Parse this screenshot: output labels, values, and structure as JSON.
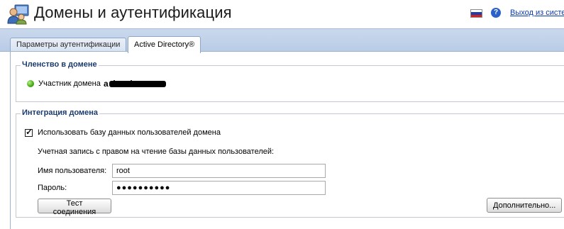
{
  "header": {
    "title": "Домены и аутентификация",
    "logout_label": "Выход из систе",
    "help_label": "?",
    "app_icon": "users-domain-icon",
    "flag_colors": [
      "#ffffff",
      "#1f3ea8",
      "#d0221c"
    ]
  },
  "tabs": [
    {
      "label": "Параметры аутентификации",
      "active": false
    },
    {
      "label": "Active Directory®",
      "active": true
    }
  ],
  "membership": {
    "legend": "Членство в домене",
    "status_label": "Участник домена",
    "domain_name": "a            .local",
    "status_color": "#4cae1c"
  },
  "integration": {
    "legend": "Интеграция домена",
    "use_domain_db_label": "Использовать базу данных пользователей домена",
    "use_domain_db_checked": true,
    "account_caption": "Учетная запись с правом на чтение базы данных пользователей:",
    "username_label": "Имя пользователя:",
    "username_value": "root",
    "password_label": "Пароль:",
    "password_mask": "●●●●●●●●●●",
    "test_button": "Тест соединения",
    "advanced_button": "Дополнительно..."
  },
  "colors": {
    "accent": "#1b3b6b",
    "link": "#0b3bb0",
    "tabbar": "#c2d3ea"
  }
}
